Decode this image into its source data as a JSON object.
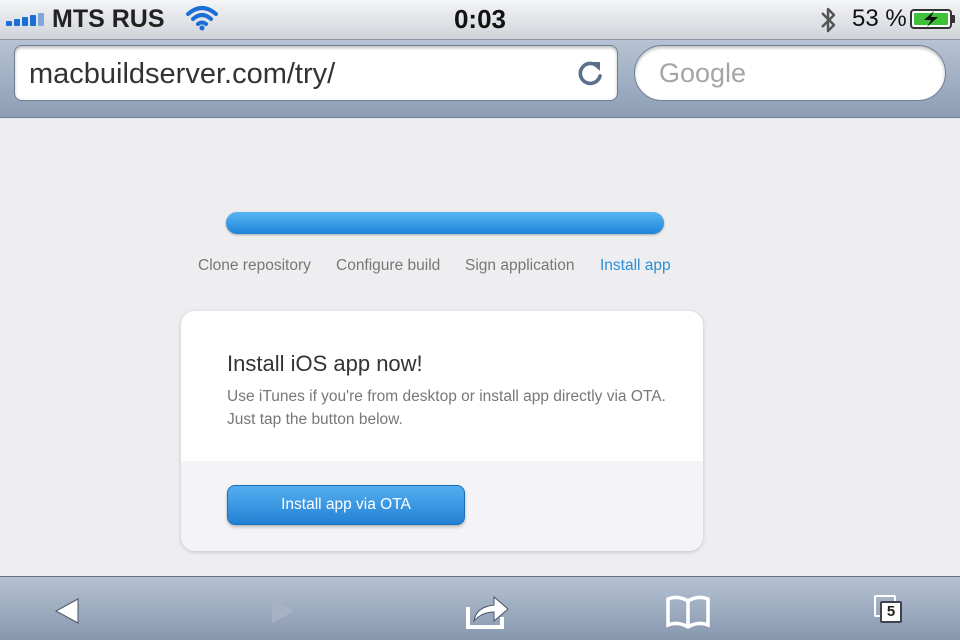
{
  "status_bar": {
    "carrier": "MTS RUS",
    "time": "0:03",
    "battery_percent": "53 %"
  },
  "address_bar": {
    "url": "macbuildserver.com/try/",
    "search_placeholder": "Google"
  },
  "page": {
    "progress_fraction": 1.0,
    "steps": [
      {
        "label": "Clone repository",
        "active": false
      },
      {
        "label": "Configure build",
        "active": false
      },
      {
        "label": "Sign application",
        "active": false
      },
      {
        "label": "Install app",
        "active": true
      }
    ],
    "card": {
      "title": "Install iOS app now!",
      "description": "Use iTunes if you're from desktop or install app directly via OTA. Just tap the button below.",
      "button_label": "Install app via OTA"
    }
  },
  "toolbar": {
    "tab_count": "5",
    "icons": [
      "back-icon",
      "forward-icon",
      "share-icon",
      "bookmarks-icon",
      "tabs-icon"
    ]
  },
  "colors": {
    "accent": "#2b8fd6",
    "progress": "#1d84d8"
  }
}
